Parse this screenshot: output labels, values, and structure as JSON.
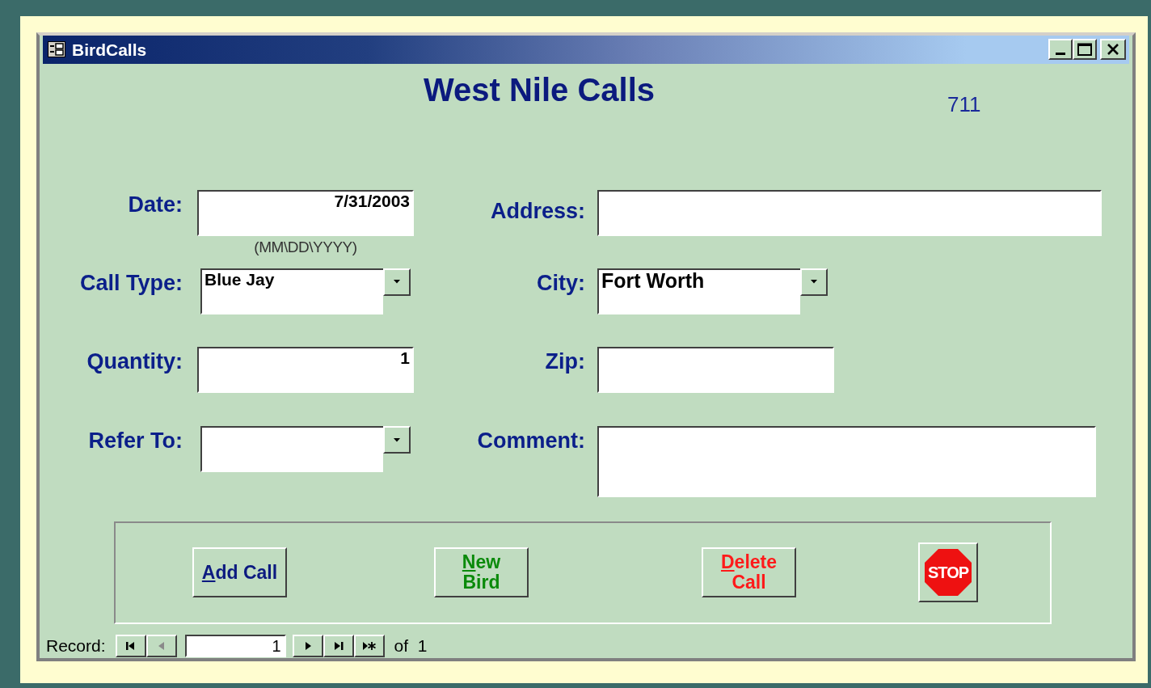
{
  "window": {
    "title": "BirdCalls"
  },
  "form": {
    "title": "West Nile Calls",
    "record_number": "711"
  },
  "rows": [
    {
      "left": {
        "label": "Date:",
        "kind": "text",
        "value": "7/31/2003",
        "hint": "(MM\\DD\\YYYY)"
      },
      "right": {
        "label": "Address:",
        "kind": "text"
      }
    },
    {
      "left": {
        "label": "Call Type:",
        "kind": "combo",
        "value": "Blue Jay"
      },
      "right": {
        "label": "City:",
        "kind": "combo",
        "value": "Fort Worth"
      }
    },
    {
      "left": {
        "label": "Quantity:",
        "kind": "number",
        "value": "1"
      },
      "right": {
        "label": "Zip:",
        "kind": "text"
      }
    },
    {
      "left": {
        "label": "Refer To:",
        "kind": "combo"
      },
      "right": {
        "label": "Comment:",
        "kind": "memo"
      }
    }
  ],
  "buttons": [
    {
      "kind": "text",
      "lines": [
        "Add Call"
      ],
      "color": "#0c1a80",
      "access_key": true
    },
    {
      "kind": "text",
      "lines": [
        "New",
        "Bird"
      ],
      "color": "#0a8a0a",
      "access_key": true
    },
    {
      "kind": "text",
      "lines": [
        "Delete",
        "Call"
      ],
      "color": "#ff1a1a",
      "access_key": true
    },
    {
      "kind": "stop",
      "lines": [
        "STOP"
      ],
      "color": "#ee1111"
    }
  ],
  "record_nav": {
    "label": "Record:",
    "value": "1",
    "total": "of  1",
    "buttons": [
      {
        "kind": "first",
        "disabled": false
      },
      {
        "kind": "prev",
        "disabled": true
      },
      {
        "kind": "next",
        "disabled": false
      },
      {
        "kind": "last",
        "disabled": false
      },
      {
        "kind": "new",
        "disabled": false
      }
    ]
  }
}
